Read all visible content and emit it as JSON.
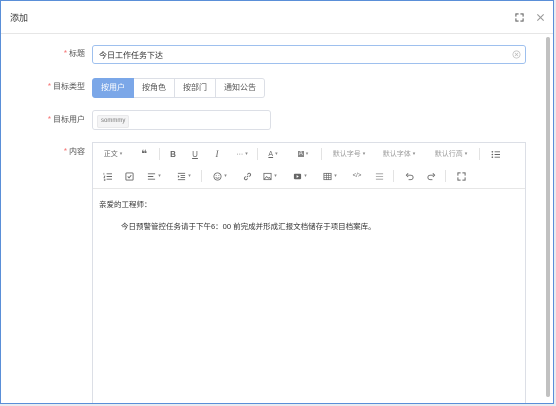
{
  "dialog": {
    "title": "添加"
  },
  "form": {
    "title_label": "标题",
    "title_value": "今日工作任务下达",
    "target_type_label": "目标类型",
    "target_types": [
      "按用户",
      "按角色",
      "按部门",
      "通知公告"
    ],
    "target_type_selected": "按用户",
    "target_user_label": "目标用户",
    "target_user_tag": "sommmy",
    "content_label": "内容",
    "required_mark": "*"
  },
  "toolbar": {
    "paragraph": "正文",
    "font_size": "默认字号",
    "font_family": "默认字体",
    "line_height": "默认行高"
  },
  "editor": {
    "greeting": "亲爱的工程师：",
    "body": "今日预警管控任务请于下午6：00  前完成并形成汇报文档储存于项目档案库。"
  }
}
